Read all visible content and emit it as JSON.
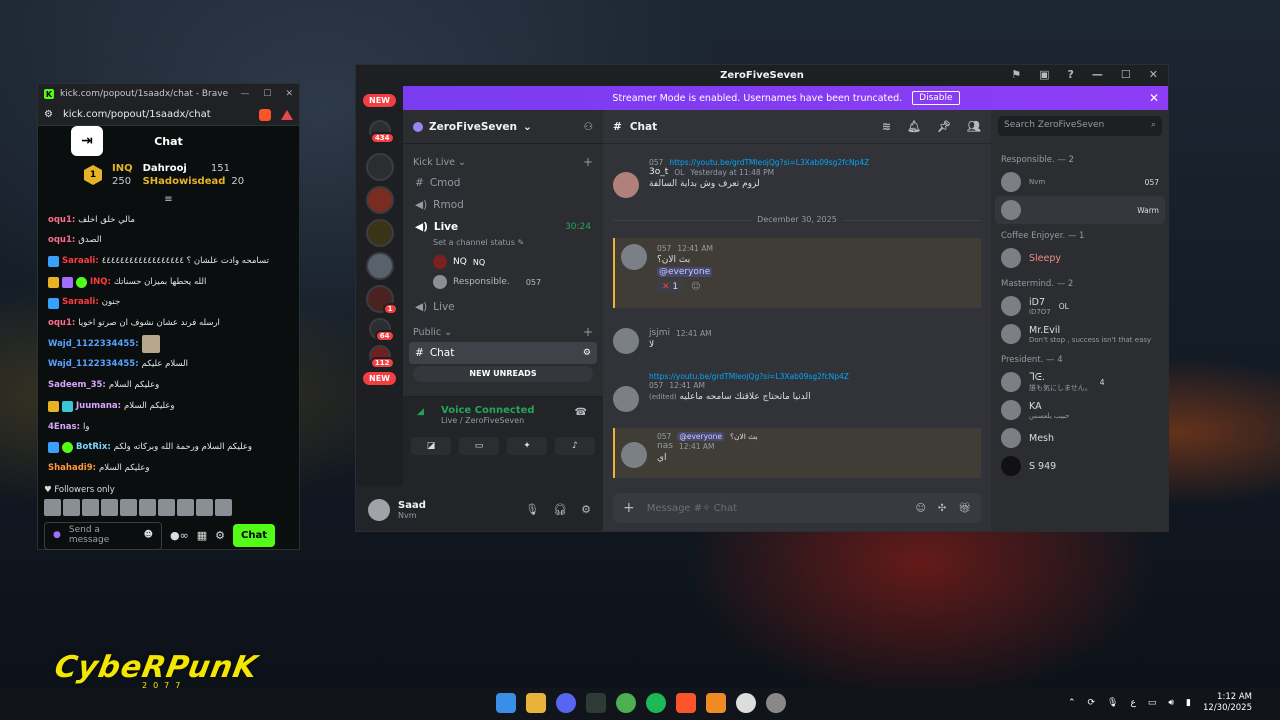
{
  "kick": {
    "tab_title": "kick.com/popout/1saadx/chat - Brave",
    "url": "kick.com/popout/1saadx/chat",
    "header_title": "Chat",
    "leaderboard": [
      {
        "name": "INQ",
        "value": "250"
      },
      {
        "name": "Dahrooj",
        "value": "151"
      },
      {
        "name": "SHadowisdead",
        "value": "20"
      }
    ],
    "messages": [
      {
        "user": "oqu1:",
        "color": "#ff6b8b",
        "text": "مالي خلق اخلف"
      },
      {
        "user": "oqu1:",
        "color": "#ff6b8b",
        "text": "الصدق"
      },
      {
        "user": "Saraali:",
        "color": "#ff3b3b",
        "text": "تسامحه وادت علشان ؟ ٤٤٤٤٤٤٤٤٤٤٤٤٤٤٤٤٤٤"
      },
      {
        "user": "INQ:",
        "color": "#ff3b3b",
        "text": "الله يحطها بميزان حسناتك"
      },
      {
        "user": "Saraali:",
        "color": "#ff3b3b",
        "text": "جنون"
      },
      {
        "user": "oqu1:",
        "color": "#ff6b8b",
        "text": "ارسله فرند عشان نشوف ان صرتو اخويا"
      },
      {
        "user": "Wajd_1122334455:",
        "color": "#5aa0ff",
        "text": ""
      },
      {
        "user": "Wajd_1122334455:",
        "color": "#5aa0ff",
        "text": "السلام عليكم"
      },
      {
        "user": "Sadeem_35:",
        "color": "#d9a6ff",
        "text": "وعليكم السلام"
      },
      {
        "user": "Juumana:",
        "color": "#d9a6ff",
        "text": "وعليكم السلام"
      },
      {
        "user": "4Enas:",
        "color": "#d9a6ff",
        "text": "وا"
      },
      {
        "user": "BotRix:",
        "color": "#7fd4ff",
        "text": "وعليكم السلام ورحمة الله وبركاته ولكم"
      },
      {
        "user": "Shahadi9:",
        "color": "#ff9a3b",
        "text": "وعليكم السلام"
      }
    ],
    "followers_only": "Followers only",
    "send_placeholder": "Send a message",
    "chat_button": "Chat"
  },
  "discord": {
    "window_title": "ZeroFiveSeven",
    "streamer_text": "Streamer Mode is enabled. Usernames have been truncated.",
    "disable_button": "Disable",
    "server_name": "ZeroFiveSeven",
    "rail_new_top": "NEW",
    "rail_new_bottom": "NEW",
    "rail_counts": [
      "434",
      "1",
      "64",
      "112"
    ],
    "channels": {
      "kick_live": "Kick Live",
      "cmod": "Cmod",
      "rmod": "Rmod",
      "live": "Live",
      "live_timer": "30:24",
      "set_status": "Set a channel status",
      "voice_user1": "NQ",
      "voice_user1b": "NQ",
      "voice_user2": "Responsible.",
      "voice_user2_tag": "057",
      "live2": "Live",
      "public": "Public",
      "chat": "Chat",
      "new_unreads": "NEW UNREADS"
    },
    "voice": {
      "status": "Voice Connected",
      "location": "Live / ZeroFiveSeven"
    },
    "user": {
      "name": "Saad",
      "status": "Nvm"
    },
    "chat": {
      "channel": "Chat",
      "date_separator": "December 30, 2025",
      "messages": [
        {
          "author": "3o_t",
          "tag": "OL",
          "time": "Yesterday at 11:48 PM",
          "link": "https://youtu.be/grdTMleojQg?si=L3Xab09sg2fcNp4Z",
          "text": "لزوم تعرف وش بداية السالفة",
          "reply_tag": "057"
        },
        {
          "author": "",
          "tag": "057",
          "time": "12:41 AM",
          "text": "بث الان؟",
          "mention": "@everyone",
          "reaction_count": "1"
        },
        {
          "author": "jsjmi",
          "time": "12:41 AM",
          "text": "لا"
        },
        {
          "author": "",
          "tag": "057",
          "time": "12:41 AM",
          "link": "https://youtu.be/grdTMleojQg?si=L3Xab09sg2fcNp4Z",
          "text": "الدنيا ماتحتاج علاقتك سامحه ماعليه",
          "edited": "(edited)"
        },
        {
          "author": "nas",
          "time": "12:41 AM",
          "reply_tag": "057",
          "reply_mention": "@everyone",
          "reply_text": "بث الان؟",
          "text": "اي"
        }
      ],
      "input_placeholder": "Message #✧ Chat"
    },
    "members": {
      "search_placeholder": "Search ZeroFiveSeven",
      "groups": [
        {
          "title": "Responsible. — 2",
          "members": [
            {
              "name": "",
              "sub": "Nvm",
              "tag": "057"
            },
            {
              "name": "",
              "sub": "",
              "tag": "Warm"
            }
          ]
        },
        {
          "title": "Coffee Enjoyer. — 1",
          "members": [
            {
              "name": "Sleepy",
              "sub": "",
              "tag": ""
            }
          ]
        },
        {
          "title": "Mastermind. — 2",
          "members": [
            {
              "name": "iD7",
              "sub": "iD7O7",
              "tag": "OL"
            },
            {
              "name": "Mr.Evil",
              "sub": "Don't stop , success isn't that easy",
              "tag": "Evil"
            }
          ]
        },
        {
          "title": "President. — 4",
          "members": [
            {
              "name": "ᒣᕮ.",
              "sub": "誰も気にしません。",
              "tag": "4"
            },
            {
              "name": "KA",
              "sub": "حبيب بلعسس",
              "tag": ""
            },
            {
              "name": "Mesh",
              "sub": "",
              "tag": ""
            },
            {
              "name": "S 949",
              "sub": "",
              "tag": ""
            }
          ]
        }
      ]
    }
  },
  "desktop": {
    "game_logo": "CybeRPunK",
    "game_logo_sub": "2077",
    "clock_time": "1:12 AM",
    "clock_date": "12/30/2025",
    "lang": "ع"
  }
}
